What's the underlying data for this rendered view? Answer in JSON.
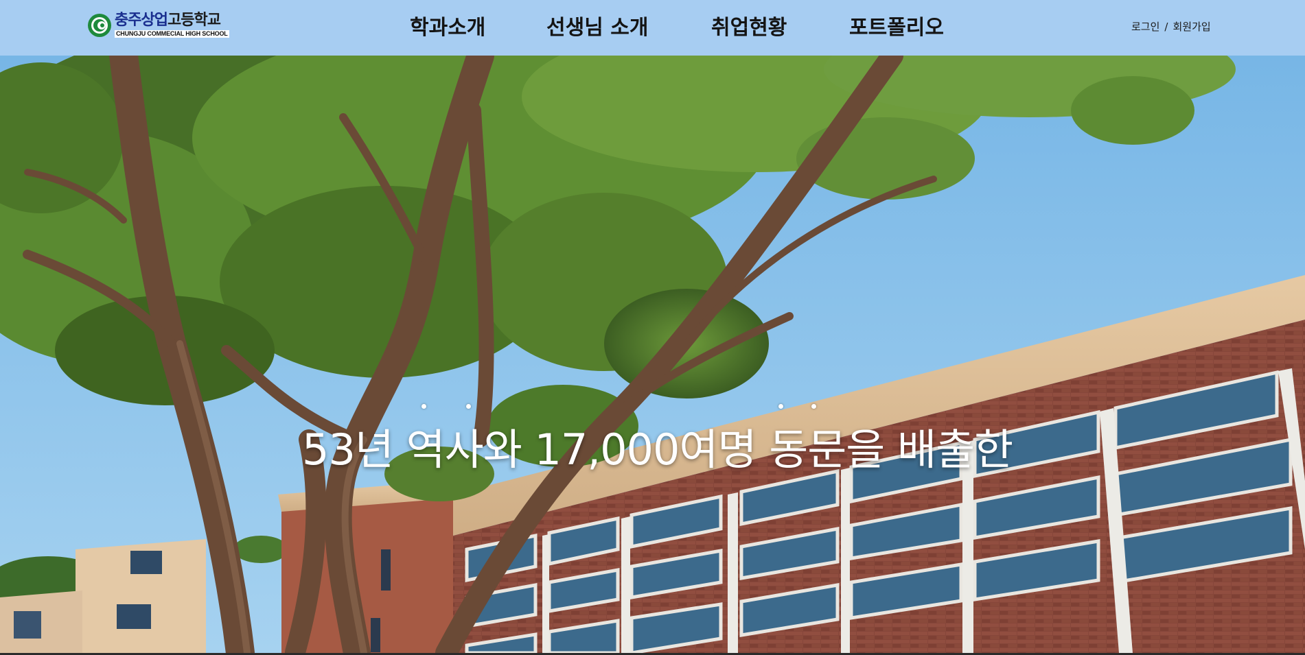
{
  "header": {
    "logo": {
      "kr_part1": "충주상업",
      "kr_part2": "고등학교",
      "en": "CHUNGJU COMMECIAL HIGH SCHOOL"
    },
    "nav": [
      {
        "label": "학과소개"
      },
      {
        "label": "선생님 소개"
      },
      {
        "label": "취업현황"
      },
      {
        "label": "포트폴리오"
      }
    ],
    "auth": {
      "login": "로그인",
      "separator": "/",
      "signup": "회원가입"
    }
  },
  "hero": {
    "caption": "53년 역사와 17,000여명 동문을 배출한",
    "colors": {
      "sky": "#8cc4ea",
      "foliage": "#4f7a2c",
      "building_beige": "#d8b891",
      "brick": "#8a4a3a"
    }
  },
  "colors": {
    "header_bg": "#a7cdf2",
    "nav_text": "#141414",
    "logo_blue": "#1a2f8f",
    "logo_green": "#1e8a3c"
  }
}
